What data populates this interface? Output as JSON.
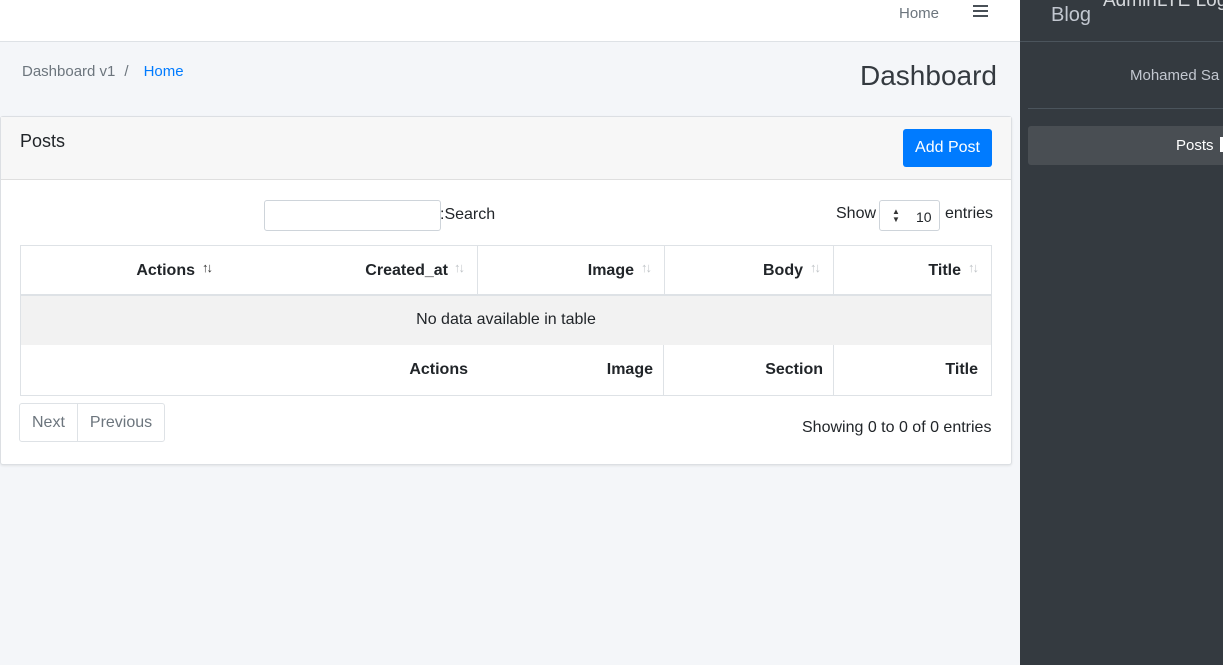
{
  "navbar": {
    "home_link": "Home"
  },
  "breadcrumb": {
    "current": "Dashboard v1",
    "separator": "/",
    "link": "Home"
  },
  "page": {
    "title": "Dashboard"
  },
  "card": {
    "title": "Posts",
    "add_button": "Add Post"
  },
  "table_controls": {
    "search_label": ":Search",
    "show_label": "Show",
    "entries_value": "10",
    "entries_label": "entries"
  },
  "table": {
    "headers": [
      "Actions",
      "Created_at",
      "Image",
      "Body",
      "Title"
    ],
    "empty_message": "No data available in table",
    "footers": [
      "Actions",
      "Image",
      "Section",
      "Title"
    ]
  },
  "pagination": {
    "next": "Next",
    "previous": "Previous",
    "info": "Showing 0 to 0 of 0 entries"
  },
  "sidebar": {
    "brand": "Blog",
    "logo_text": "AdminLTE Logo",
    "user_name": "Mohamed Sa",
    "nav_item": "Posts"
  },
  "colors": {
    "primary": "#007bff",
    "sidebar_bg": "#343a40",
    "page_bg": "#f4f6f9"
  }
}
